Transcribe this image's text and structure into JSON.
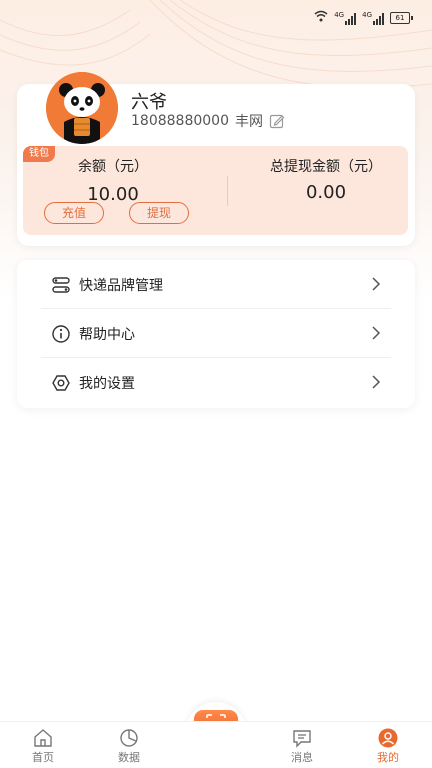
{
  "status_bar": {
    "signal_1": "4G",
    "signal_2": "4G",
    "battery": "61"
  },
  "profile": {
    "name": "六爷",
    "phone": "18088880000",
    "network": "丰网"
  },
  "wallet": {
    "tag": "钱包",
    "balance_label": "余额（元）",
    "balance_value": "10.00",
    "withdrawn_label": "总提现金额（元）",
    "withdrawn_value": "0.00",
    "recharge_label": "充值",
    "withdraw_label": "提现"
  },
  "menu": [
    {
      "label": "快递品牌管理",
      "icon": "switch-icon"
    },
    {
      "label": "帮助中心",
      "icon": "info-icon"
    },
    {
      "label": "我的设置",
      "icon": "settings-icon"
    }
  ],
  "bottom_nav": {
    "home": "首页",
    "data": "数据",
    "messages": "消息",
    "mine": "我的",
    "active": "mine"
  },
  "colors": {
    "accent": "#e8692f",
    "wallet_bg": "#fde6dc"
  }
}
